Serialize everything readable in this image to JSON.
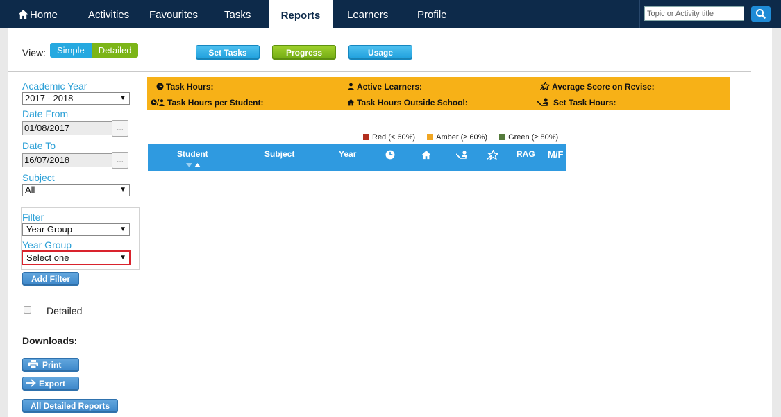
{
  "nav": {
    "items": [
      "Home",
      "Activities",
      "Favourites",
      "Tasks",
      "Reports",
      "Learners",
      "Profile"
    ],
    "active": "Reports",
    "search_placeholder": "Topic or Activity title"
  },
  "view": {
    "label": "View:",
    "simple": "Simple",
    "detailed": "Detailed",
    "selected": "Detailed"
  },
  "actions": {
    "set_tasks": "Set Tasks",
    "progress": "Progress",
    "usage": "Usage"
  },
  "sidebar": {
    "academic_year_label": "Academic Year",
    "academic_year_value": "2017 - 2018",
    "date_from_label": "Date From",
    "date_from_value": "01/08/2017",
    "date_to_label": "Date To",
    "date_to_value": "16/07/2018",
    "picker": "...",
    "subject_label": "Subject",
    "subject_value": "All",
    "filter_label": "Filter",
    "filter_value": "Year Group",
    "year_group_label": "Year Group",
    "year_group_value": "Select one",
    "add_filter": "Add Filter",
    "detailed_checkbox_label": "Detailed",
    "downloads_label": "Downloads:",
    "print": "Print",
    "export": "Export",
    "all_detailed_reports": "All Detailed Reports"
  },
  "summary": {
    "task_hours": "Task Hours:",
    "active_learners": "Active Learners:",
    "average_score": "Average Score on Revise:",
    "task_hours_per_student": "Task Hours per Student:",
    "task_hours_outside": "Task Hours Outside School:",
    "set_task_hours": "Set Task Hours:"
  },
  "legend": {
    "red": "Red (< 60%)",
    "amber": "Amber (≥ 60%)",
    "green": "Green (≥ 80%)",
    "colors": {
      "red": "#b22f1e",
      "amber": "#f0a623",
      "green": "#547a3b"
    }
  },
  "table": {
    "student": "Student",
    "subject": "Subject",
    "year": "Year",
    "rag": "RAG",
    "mf": "M/F"
  },
  "colors": {
    "nav": "#0d2a4a",
    "accent_blue": "#2f9ae0",
    "accent_green": "#7cb518",
    "summary": "#f7b117",
    "highlight": "#d9232d"
  }
}
